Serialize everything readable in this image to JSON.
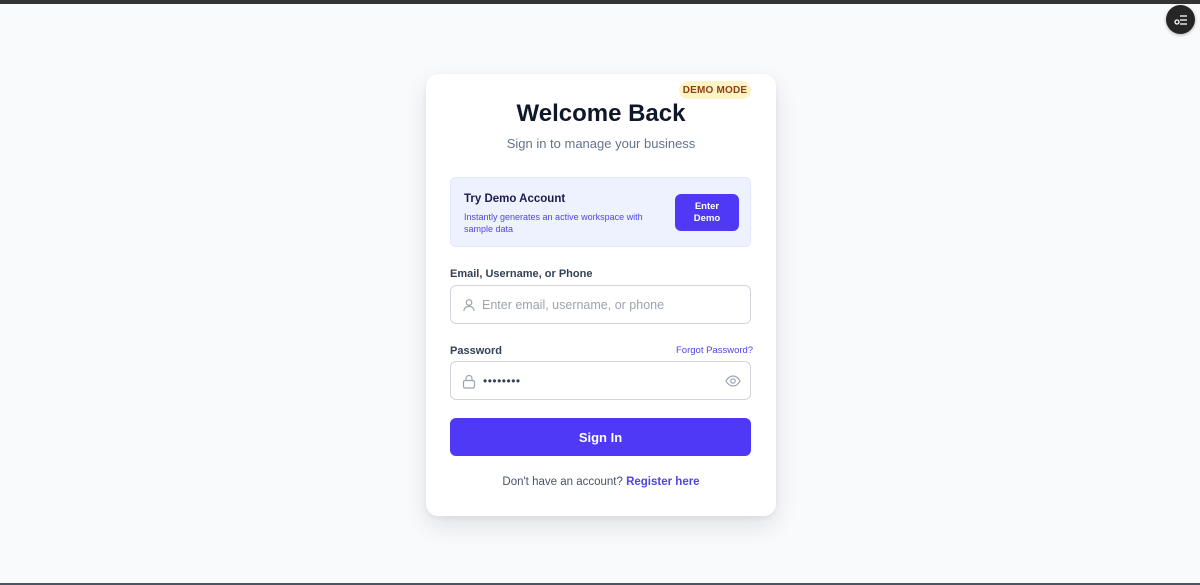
{
  "badge": "DEMO MODE",
  "heading": "Welcome Back",
  "subheading": "Sign in to manage your business",
  "demo": {
    "title": "Try Demo Account",
    "description": "Instantly generates an active workspace with sample data",
    "button": "Enter Demo"
  },
  "login_field": {
    "label": "Email, Username, or Phone",
    "placeholder": "Enter email, username, or phone",
    "value": "",
    "icon": "user-icon"
  },
  "password_field": {
    "label": "Password",
    "forgot": "Forgot Password?",
    "masked_value": "••••••••",
    "icon": "lock-icon",
    "toggle_icon": "eye-icon"
  },
  "submit": "Sign In",
  "register": {
    "prompt": "Don't have an account?",
    "link": "Register here"
  },
  "fab_icon": "settings-menu-icon",
  "colors": {
    "accent": "#4f39f6",
    "link": "#4f46e5",
    "badge_bg": "#fef3c7",
    "badge_text": "#92400e",
    "demo_bg": "#eef2ff",
    "page_bg": "#f8fafc"
  }
}
